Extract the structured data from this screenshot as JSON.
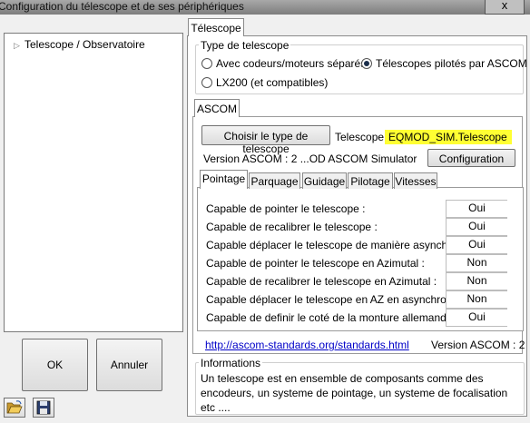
{
  "window": {
    "title": "Configuration du télescope et de ses périphériques",
    "close_glyph": "x"
  },
  "tree": {
    "arrow": "▷",
    "item": "Telescope / Observatoire"
  },
  "buttons": {
    "ok": "OK",
    "cancel": "Annuler"
  },
  "tabs": {
    "telescope": "Télescope"
  },
  "telescope_type": {
    "title": "Type de telescope",
    "options": [
      {
        "label": "Avec codeurs/moteurs séparés",
        "selected": false
      },
      {
        "label": "Télescopes pilotés par ASCOM",
        "selected": true
      },
      {
        "label": "LX200 (et compatibles)",
        "selected": false
      }
    ]
  },
  "ascom": {
    "tab": "ASCOM",
    "choose_button": "Choisir le type de telescope",
    "telescope_label": "Telescope :",
    "telescope_value": "EQMOD_SIM.Telescope",
    "version_text": "Version ASCOM : 2 ...OD ASCOM Simulator",
    "config_button": "Configuration",
    "subtabs": [
      "Pointage",
      "Parquage",
      "Guidage",
      "Pilotage",
      "Vitesses"
    ],
    "active_subtab": "Pointage",
    "capabilities": [
      {
        "label": "Capable de pointer le telescope :",
        "value": "Oui"
      },
      {
        "label": "Capable de recalibrer le telescope :",
        "value": "Oui"
      },
      {
        "label": "Capable déplacer le telescope de manière asynchrone :",
        "value": "Oui"
      },
      {
        "label": "Capable de pointer le telescope en Azimutal :",
        "value": "Non"
      },
      {
        "label": "Capable de recalibrer le telescope en Azimutal :",
        "value": "Non"
      },
      {
        "label": "Capable déplacer le telescope en AZ en asynchrone :",
        "value": "Non"
      },
      {
        "label": "Capable de definir le coté de la monture allemande :",
        "value": "Oui"
      }
    ],
    "link": "http://ascom-standards.org/standards.html",
    "version_short": "Version ASCOM : 2"
  },
  "info": {
    "title": "Informations",
    "text": "Un telescope est en ensemble de composants comme des encodeurs, un systeme de pointage, un systeme de focalisation etc ...."
  },
  "colors": {
    "highlight": "#ffff33",
    "link": "#0000c8",
    "titlebar": "#8a8a8a"
  },
  "icons": {
    "open": "folder-open-icon",
    "save": "floppy-disk-icon"
  }
}
